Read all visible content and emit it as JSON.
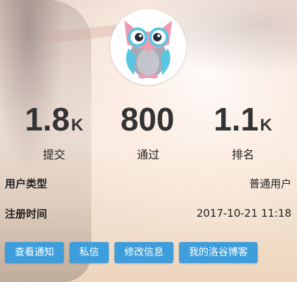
{
  "profile": {
    "stats": [
      {
        "number": "1.8",
        "unit": "K",
        "label": "提交"
      },
      {
        "number": "800",
        "unit": "",
        "label": "通过"
      },
      {
        "number": "1.1",
        "unit": "K",
        "label": "排名"
      }
    ],
    "info": [
      {
        "key": "用户类型",
        "value": "普通用户"
      },
      {
        "key": "注册时间",
        "value": "2017-10-21 11:18"
      }
    ],
    "buttons": [
      "查看通知",
      "私信",
      "修改信息",
      "我的洛谷博客"
    ],
    "avatar_icon": "owl-avatar-icon"
  }
}
